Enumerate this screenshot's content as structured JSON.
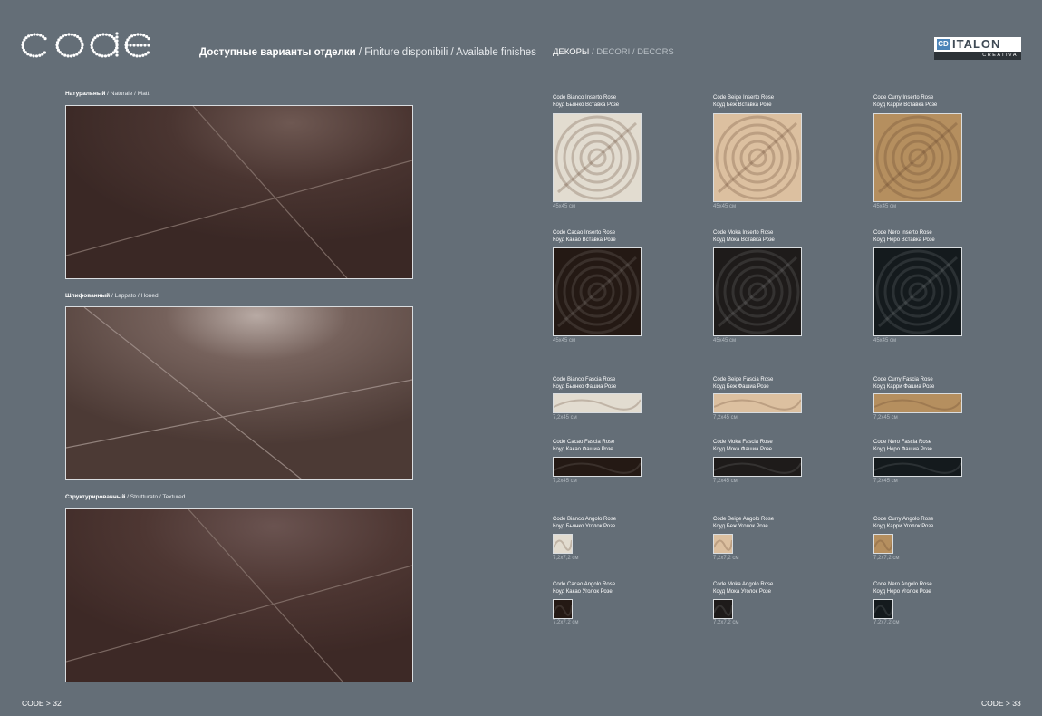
{
  "logo": {
    "text": "code"
  },
  "header": {
    "title_bold": "Доступные варианты отделки",
    "title_rest": " / Finiture disponibili / Available finishes",
    "decor_bold": "ДЕКОРЫ",
    "decor_rest": " / DECORI / DECORS"
  },
  "brand": {
    "name": "ITALON",
    "sub": "CREATIVA",
    "mark": "CD"
  },
  "finishes": [
    {
      "bold": "Натуральный",
      "rest": " / Naturale / Matt"
    },
    {
      "bold": "Шлифованный",
      "rest": " / Lappato / Honed"
    },
    {
      "bold": "Структурированный",
      "rest": " / Strutturato / Textured"
    }
  ],
  "decors": [
    {
      "name_it": "Code Bianco Inserto Rose",
      "name_ru": "Коуд Бьянко Вставка Розе",
      "size": "45x45 см",
      "color": "#e2dcd0"
    },
    {
      "name_it": "Code Beige Inserto Rose",
      "name_ru": "Коуд Беж Вставка Розе",
      "size": "45x45 см",
      "color": "#dcc0a0"
    },
    {
      "name_it": "Code Curry Inserto Rose",
      "name_ru": "Коуд Карри Вставка Розе",
      "size": "45x45 см",
      "color": "#b58f5f"
    },
    {
      "name_it": "Code Cacao Inserto Rose",
      "name_ru": "Коуд Какао Вставка Розе",
      "size": "45x45 см",
      "color": "#241914"
    },
    {
      "name_it": "Code Moka Inserto Rose",
      "name_ru": "Коуд Мока Вставка Розе",
      "size": "45x45 см",
      "color": "#1e1b1a"
    },
    {
      "name_it": "Code Nero Inserto Rose",
      "name_ru": "Коуд Неро Вставка Розе",
      "size": "45x45 см",
      "color": "#141a1d"
    },
    {
      "name_it": "Code Bianco Fascia Rose",
      "name_ru": "Коуд Бьянко Фашиа Розе",
      "size": "7,2x45 см",
      "color": "#e2dcd0"
    },
    {
      "name_it": "Code Beige Fascia Rose",
      "name_ru": "Коуд Беж Фашиа Розе",
      "size": "7,2x45 см",
      "color": "#dcc0a0"
    },
    {
      "name_it": "Code Curry Fascia Rose",
      "name_ru": "Коуд Карри Фашиа Розе",
      "size": "7,2x45 см",
      "color": "#b58f5f"
    },
    {
      "name_it": "Code Cacao Fascia Rose",
      "name_ru": "Коуд Какао Фашиа Розе",
      "size": "7,2x45 см",
      "color": "#241914"
    },
    {
      "name_it": "Code Moka Fascia Rose",
      "name_ru": "Коуд Мока Фашиа Розе",
      "size": "7,2x45 см",
      "color": "#1e1b1a"
    },
    {
      "name_it": "Code Nero Fascia Rose",
      "name_ru": "Коуд Неро Фашиа Розе",
      "size": "7,2x45 см",
      "color": "#141a1d"
    },
    {
      "name_it": "Code Bianco Angolo Rose",
      "name_ru": "Коуд Бьянко Уголок Розе",
      "size": "7,2x7,2 см",
      "color": "#e2dcd0"
    },
    {
      "name_it": "Code Beige Angolo Rose",
      "name_ru": "Коуд Беж Уголок Розе",
      "size": "7,2x7,2 см",
      "color": "#dcc0a0"
    },
    {
      "name_it": "Code Curry Angolo Rose",
      "name_ru": "Коуд Карри Уголок Розе",
      "size": "7,2x7,2 см",
      "color": "#b58f5f"
    },
    {
      "name_it": "Code Cacao Angolo Rose",
      "name_ru": "Коуд Какао Уголок Розе",
      "size": "7,2x7,2 см",
      "color": "#241914"
    },
    {
      "name_it": "Code Moka Angolo Rose",
      "name_ru": "Коуд Мока Уголок Розе",
      "size": "7,2x7,2 см",
      "color": "#1e1b1a"
    },
    {
      "name_it": "Code Nero Angolo Rose",
      "name_ru": "Коуд Неро Уголок Розе",
      "size": "7,2x7,2 см",
      "color": "#141a1d"
    }
  ],
  "footer": {
    "left": "CODE > 32",
    "right": "CODE > 33"
  }
}
